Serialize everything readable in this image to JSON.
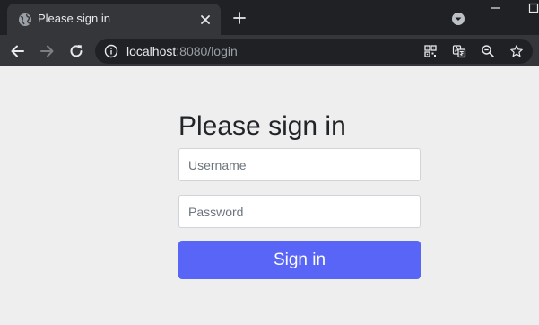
{
  "browser": {
    "tab": {
      "title": "Please sign in",
      "favicon": "globe-icon"
    },
    "url": {
      "host": "localhost",
      "rest": ":8080/login"
    },
    "colors": {
      "tabstrip": "#202124",
      "toolbar": "#35363a",
      "omnibox": "#202124"
    }
  },
  "page": {
    "heading": "Please sign in",
    "username": {
      "placeholder": "Username",
      "value": ""
    },
    "password": {
      "placeholder": "Password",
      "value": ""
    },
    "submit_label": "Sign in",
    "colors": {
      "background": "#eeeeee",
      "button": "#5865f7",
      "button_text": "#ffffff"
    }
  }
}
